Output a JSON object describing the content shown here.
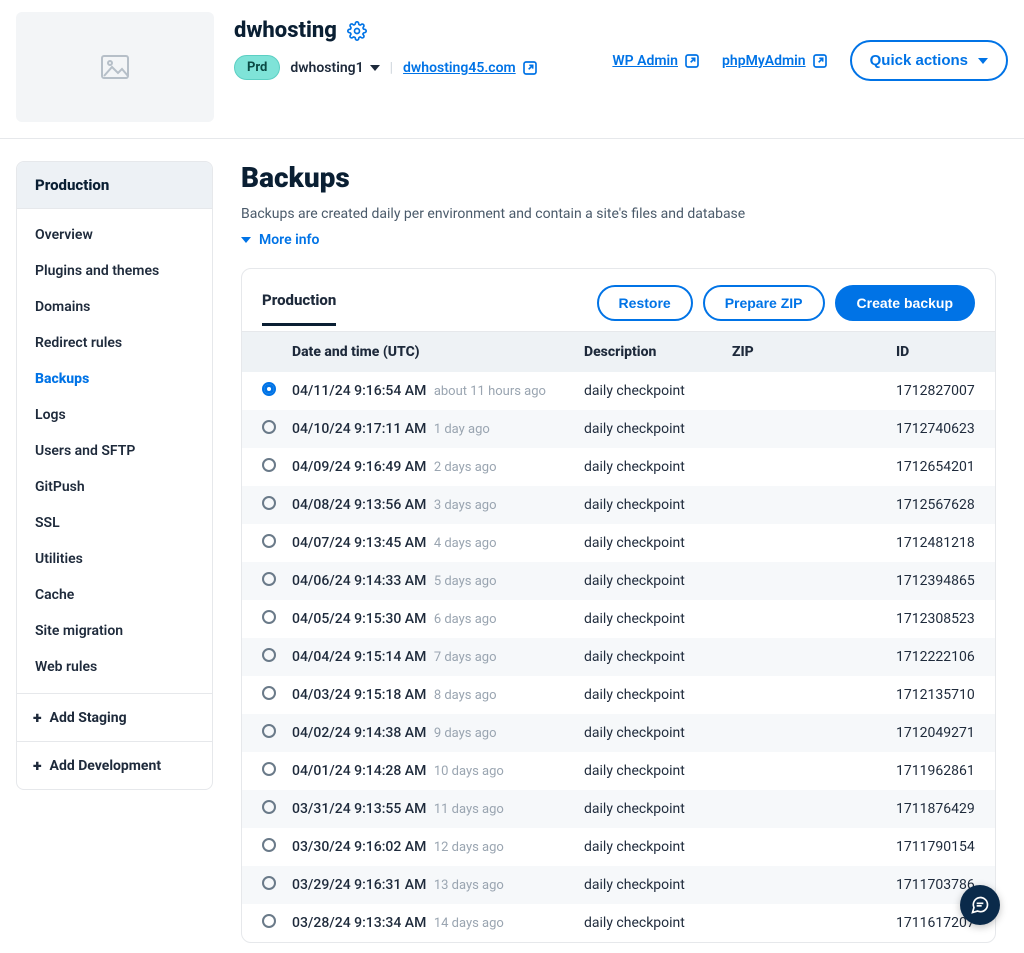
{
  "header": {
    "site_title": "dwhosting",
    "env_pill": "Prd",
    "env_name": "dwhosting1",
    "domain_link": "dwhosting45.com",
    "wp_admin": "WP Admin",
    "php_my_admin": "phpMyAdmin",
    "quick_actions": "Quick actions"
  },
  "sidebar": {
    "heading": "Production",
    "items": [
      {
        "label": "Overview",
        "active": false
      },
      {
        "label": "Plugins and themes",
        "active": false
      },
      {
        "label": "Domains",
        "active": false
      },
      {
        "label": "Redirect rules",
        "active": false
      },
      {
        "label": "Backups",
        "active": true
      },
      {
        "label": "Logs",
        "active": false
      },
      {
        "label": "Users and SFTP",
        "active": false
      },
      {
        "label": "GitPush",
        "active": false
      },
      {
        "label": "SSL",
        "active": false
      },
      {
        "label": "Utilities",
        "active": false
      },
      {
        "label": "Cache",
        "active": false
      },
      {
        "label": "Site migration",
        "active": false
      },
      {
        "label": "Web rules",
        "active": false
      }
    ],
    "add_staging": "Add Staging",
    "add_dev": "Add Development"
  },
  "main": {
    "page_title": "Backups",
    "subtitle": "Backups are created daily per environment and contain a site's files and database",
    "more_info": "More info",
    "tab_label": "Production",
    "restore": "Restore",
    "prepare_zip": "Prepare ZIP",
    "create_backup": "Create backup",
    "columns": {
      "dt": "Date and time (UTC)",
      "desc": "Description",
      "zip": "ZIP",
      "id": "ID"
    },
    "rows": [
      {
        "dt": "04/11/24 9:16:54 AM",
        "ago": "about 11 hours ago",
        "desc": "daily checkpoint",
        "zip": "",
        "id": "1712827007",
        "selected": true
      },
      {
        "dt": "04/10/24 9:17:11 AM",
        "ago": "1 day ago",
        "desc": "daily checkpoint",
        "zip": "",
        "id": "1712740623",
        "selected": false
      },
      {
        "dt": "04/09/24 9:16:49 AM",
        "ago": "2 days ago",
        "desc": "daily checkpoint",
        "zip": "",
        "id": "1712654201",
        "selected": false
      },
      {
        "dt": "04/08/24 9:13:56 AM",
        "ago": "3 days ago",
        "desc": "daily checkpoint",
        "zip": "",
        "id": "1712567628",
        "selected": false
      },
      {
        "dt": "04/07/24 9:13:45 AM",
        "ago": "4 days ago",
        "desc": "daily checkpoint",
        "zip": "",
        "id": "1712481218",
        "selected": false
      },
      {
        "dt": "04/06/24 9:14:33 AM",
        "ago": "5 days ago",
        "desc": "daily checkpoint",
        "zip": "",
        "id": "1712394865",
        "selected": false
      },
      {
        "dt": "04/05/24 9:15:30 AM",
        "ago": "6 days ago",
        "desc": "daily checkpoint",
        "zip": "",
        "id": "1712308523",
        "selected": false
      },
      {
        "dt": "04/04/24 9:15:14 AM",
        "ago": "7 days ago",
        "desc": "daily checkpoint",
        "zip": "",
        "id": "1712222106",
        "selected": false
      },
      {
        "dt": "04/03/24 9:15:18 AM",
        "ago": "8 days ago",
        "desc": "daily checkpoint",
        "zip": "",
        "id": "1712135710",
        "selected": false
      },
      {
        "dt": "04/02/24 9:14:38 AM",
        "ago": "9 days ago",
        "desc": "daily checkpoint",
        "zip": "",
        "id": "1712049271",
        "selected": false
      },
      {
        "dt": "04/01/24 9:14:28 AM",
        "ago": "10 days ago",
        "desc": "daily checkpoint",
        "zip": "",
        "id": "1711962861",
        "selected": false
      },
      {
        "dt": "03/31/24 9:13:55 AM",
        "ago": "11 days ago",
        "desc": "daily checkpoint",
        "zip": "",
        "id": "1711876429",
        "selected": false
      },
      {
        "dt": "03/30/24 9:16:02 AM",
        "ago": "12 days ago",
        "desc": "daily checkpoint",
        "zip": "",
        "id": "1711790154",
        "selected": false
      },
      {
        "dt": "03/29/24 9:16:31 AM",
        "ago": "13 days ago",
        "desc": "daily checkpoint",
        "zip": "",
        "id": "1711703786",
        "selected": false
      },
      {
        "dt": "03/28/24 9:13:34 AM",
        "ago": "14 days ago",
        "desc": "daily checkpoint",
        "zip": "",
        "id": "1711617207",
        "selected": false
      }
    ]
  }
}
